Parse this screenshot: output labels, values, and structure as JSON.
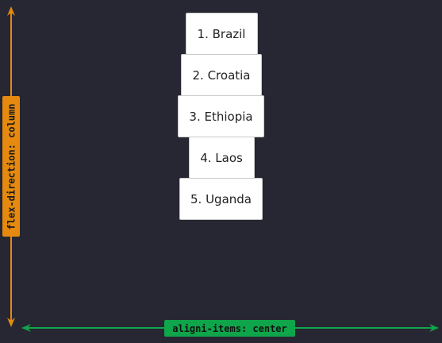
{
  "items": [
    {
      "label": "1. Brazil"
    },
    {
      "label": "2. Croatia"
    },
    {
      "label": "3. Ethiopia"
    },
    {
      "label": "4. Laos"
    },
    {
      "label": "5. Uganda"
    }
  ],
  "axis_labels": {
    "vertical": "flex-direction: column",
    "horizontal": "aligni-items: center"
  },
  "colors": {
    "background": "#272733",
    "item_background": "#ffffff",
    "vertical_arrow": "#e58a0f",
    "horizontal_arrow": "#0fa54a"
  }
}
